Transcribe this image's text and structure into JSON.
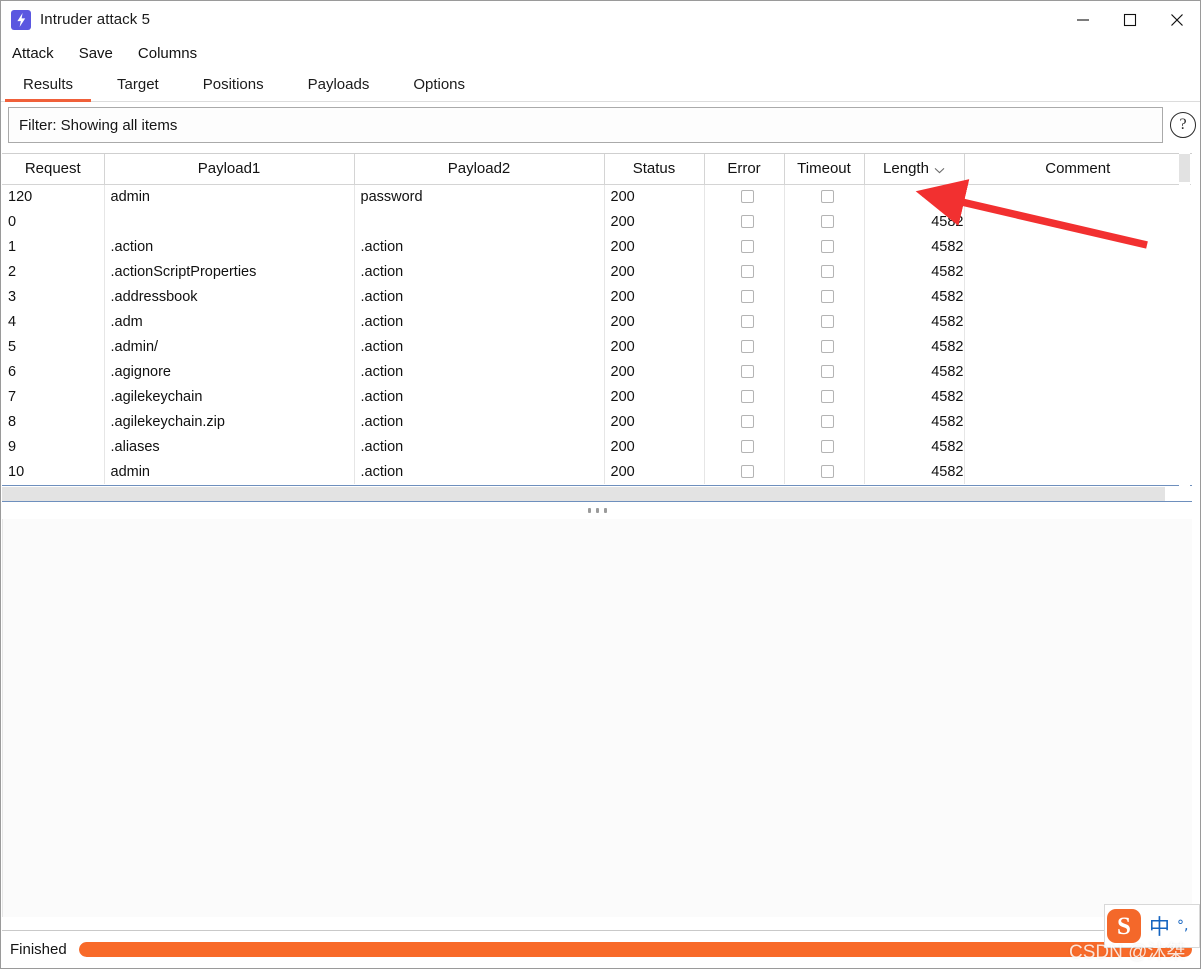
{
  "window": {
    "title": "Intruder attack 5",
    "icon": "lightning-bolt-icon",
    "controls": {
      "minimize": "minimize-icon",
      "maximize": "maximize-icon",
      "close": "close-icon"
    }
  },
  "menubar": {
    "items": [
      {
        "label": "Attack"
      },
      {
        "label": "Save"
      },
      {
        "label": "Columns"
      }
    ]
  },
  "tabs": {
    "active": "Results",
    "items": [
      {
        "label": "Results"
      },
      {
        "label": "Target"
      },
      {
        "label": "Positions"
      },
      {
        "label": "Payloads"
      },
      {
        "label": "Options"
      }
    ]
  },
  "filter": {
    "text": "Filter: Showing all items",
    "help_glyph": "?"
  },
  "table": {
    "columns": [
      {
        "key": "request",
        "label": "Request"
      },
      {
        "key": "payload1",
        "label": "Payload1"
      },
      {
        "key": "payload2",
        "label": "Payload2"
      },
      {
        "key": "status",
        "label": "Status"
      },
      {
        "key": "error",
        "label": "Error"
      },
      {
        "key": "timeout",
        "label": "Timeout"
      },
      {
        "key": "length",
        "label": "Length",
        "sorted": true,
        "sort_dir": "desc"
      },
      {
        "key": "comment",
        "label": "Comment"
      }
    ],
    "rows": [
      {
        "request": "120",
        "payload1": "admin",
        "payload2": "password",
        "status": "200",
        "error": false,
        "timeout": false,
        "length": "4632",
        "comment": ""
      },
      {
        "request": "0",
        "payload1": "",
        "payload2": "",
        "status": "200",
        "error": false,
        "timeout": false,
        "length": "4582",
        "comment": ""
      },
      {
        "request": "1",
        "payload1": ".action",
        "payload2": ".action",
        "status": "200",
        "error": false,
        "timeout": false,
        "length": "4582",
        "comment": ""
      },
      {
        "request": "2",
        "payload1": ".actionScriptProperties",
        "payload2": ".action",
        "status": "200",
        "error": false,
        "timeout": false,
        "length": "4582",
        "comment": ""
      },
      {
        "request": "3",
        "payload1": ".addressbook",
        "payload2": ".action",
        "status": "200",
        "error": false,
        "timeout": false,
        "length": "4582",
        "comment": ""
      },
      {
        "request": "4",
        "payload1": ".adm",
        "payload2": ".action",
        "status": "200",
        "error": false,
        "timeout": false,
        "length": "4582",
        "comment": ""
      },
      {
        "request": "5",
        "payload1": ".admin/",
        "payload2": ".action",
        "status": "200",
        "error": false,
        "timeout": false,
        "length": "4582",
        "comment": ""
      },
      {
        "request": "6",
        "payload1": ".agignore",
        "payload2": ".action",
        "status": "200",
        "error": false,
        "timeout": false,
        "length": "4582",
        "comment": ""
      },
      {
        "request": "7",
        "payload1": ".agilekeychain",
        "payload2": ".action",
        "status": "200",
        "error": false,
        "timeout": false,
        "length": "4582",
        "comment": ""
      },
      {
        "request": "8",
        "payload1": ".agilekeychain.zip",
        "payload2": ".action",
        "status": "200",
        "error": false,
        "timeout": false,
        "length": "4582",
        "comment": ""
      },
      {
        "request": "9",
        "payload1": ".aliases",
        "payload2": ".action",
        "status": "200",
        "error": false,
        "timeout": false,
        "length": "4582",
        "comment": ""
      },
      {
        "request": "10",
        "payload1": "admin",
        "payload2": ".action",
        "status": "200",
        "error": false,
        "timeout": false,
        "length": "4582",
        "comment": ""
      }
    ]
  },
  "statusbar": {
    "label": "Finished",
    "progress_percent": 100
  },
  "annotation": {
    "type": "red-arrow",
    "color": "#F23030",
    "points_to": "length-value-4632"
  },
  "ime": {
    "logo_letter": "S",
    "mode": "中",
    "punctuation": "°,"
  },
  "watermark": {
    "text": "CSDN @沐桀"
  },
  "colors": {
    "accent": "#F0603A",
    "progress": "#F86A29",
    "app_icon": "#5B57E0",
    "annotation": "#F23030",
    "ime_logo": "#F4682A",
    "ime_text": "#1564C0"
  }
}
